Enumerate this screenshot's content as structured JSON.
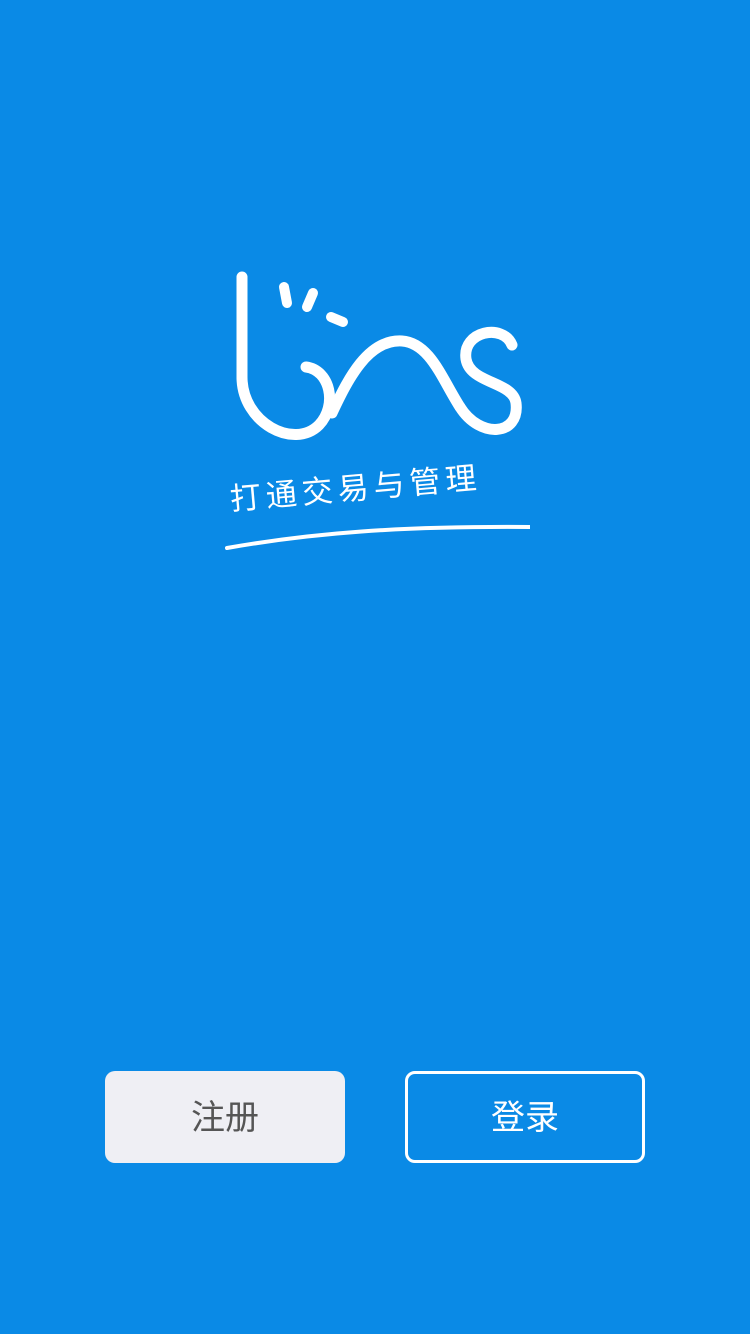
{
  "app": {
    "logo_name": "bns-logo",
    "slogan": "打通交易与管理"
  },
  "actions": {
    "register_label": "注册",
    "login_label": "登录"
  },
  "colors": {
    "background": "#0a8ae6",
    "register_bg": "#efeff4",
    "register_text": "#555555",
    "login_border": "#ffffff",
    "login_text": "#ffffff"
  }
}
